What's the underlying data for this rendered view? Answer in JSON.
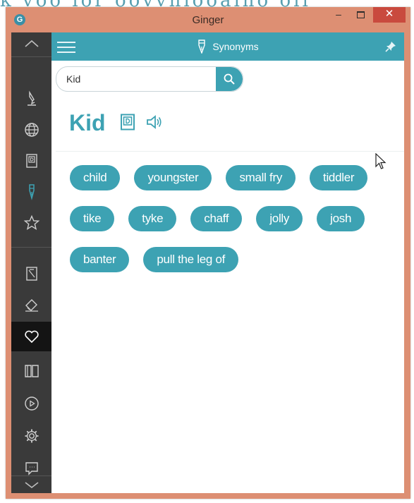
{
  "window": {
    "title": "Ginger"
  },
  "window_controls": {
    "minimize": "–",
    "close": "✕"
  },
  "app_icon_letter": "G",
  "topbar": {
    "title": "Synonyms"
  },
  "search": {
    "value": "Kid"
  },
  "word": "Kid",
  "synonyms": [
    "child",
    "youngster",
    "small fry",
    "tiddler",
    "tike",
    "tyke",
    "chaff",
    "jolly",
    "josh",
    "banter",
    "pull the leg of"
  ],
  "sidebar": {
    "items": [
      {
        "icon": "chevron-up-icon"
      },
      {
        "icon": "pen-icon"
      },
      {
        "icon": "globe-icon"
      },
      {
        "icon": "dictionary-icon"
      },
      {
        "icon": "fountain-pen-icon",
        "active_color": "#3da2b3"
      },
      {
        "icon": "star-icon"
      },
      {
        "icon": "notebook-icon"
      },
      {
        "icon": "eraser-icon"
      },
      {
        "icon": "heart-icon",
        "selected": true
      },
      {
        "icon": "book-icon"
      },
      {
        "icon": "play-icon"
      },
      {
        "icon": "gear-icon"
      },
      {
        "icon": "chat-icon"
      },
      {
        "icon": "chevron-down-icon"
      }
    ]
  },
  "colors": {
    "accent": "#3da2b3",
    "frame": "#dd8f73",
    "sidebar": "#3a3a3a",
    "close": "#c94a3e"
  }
}
